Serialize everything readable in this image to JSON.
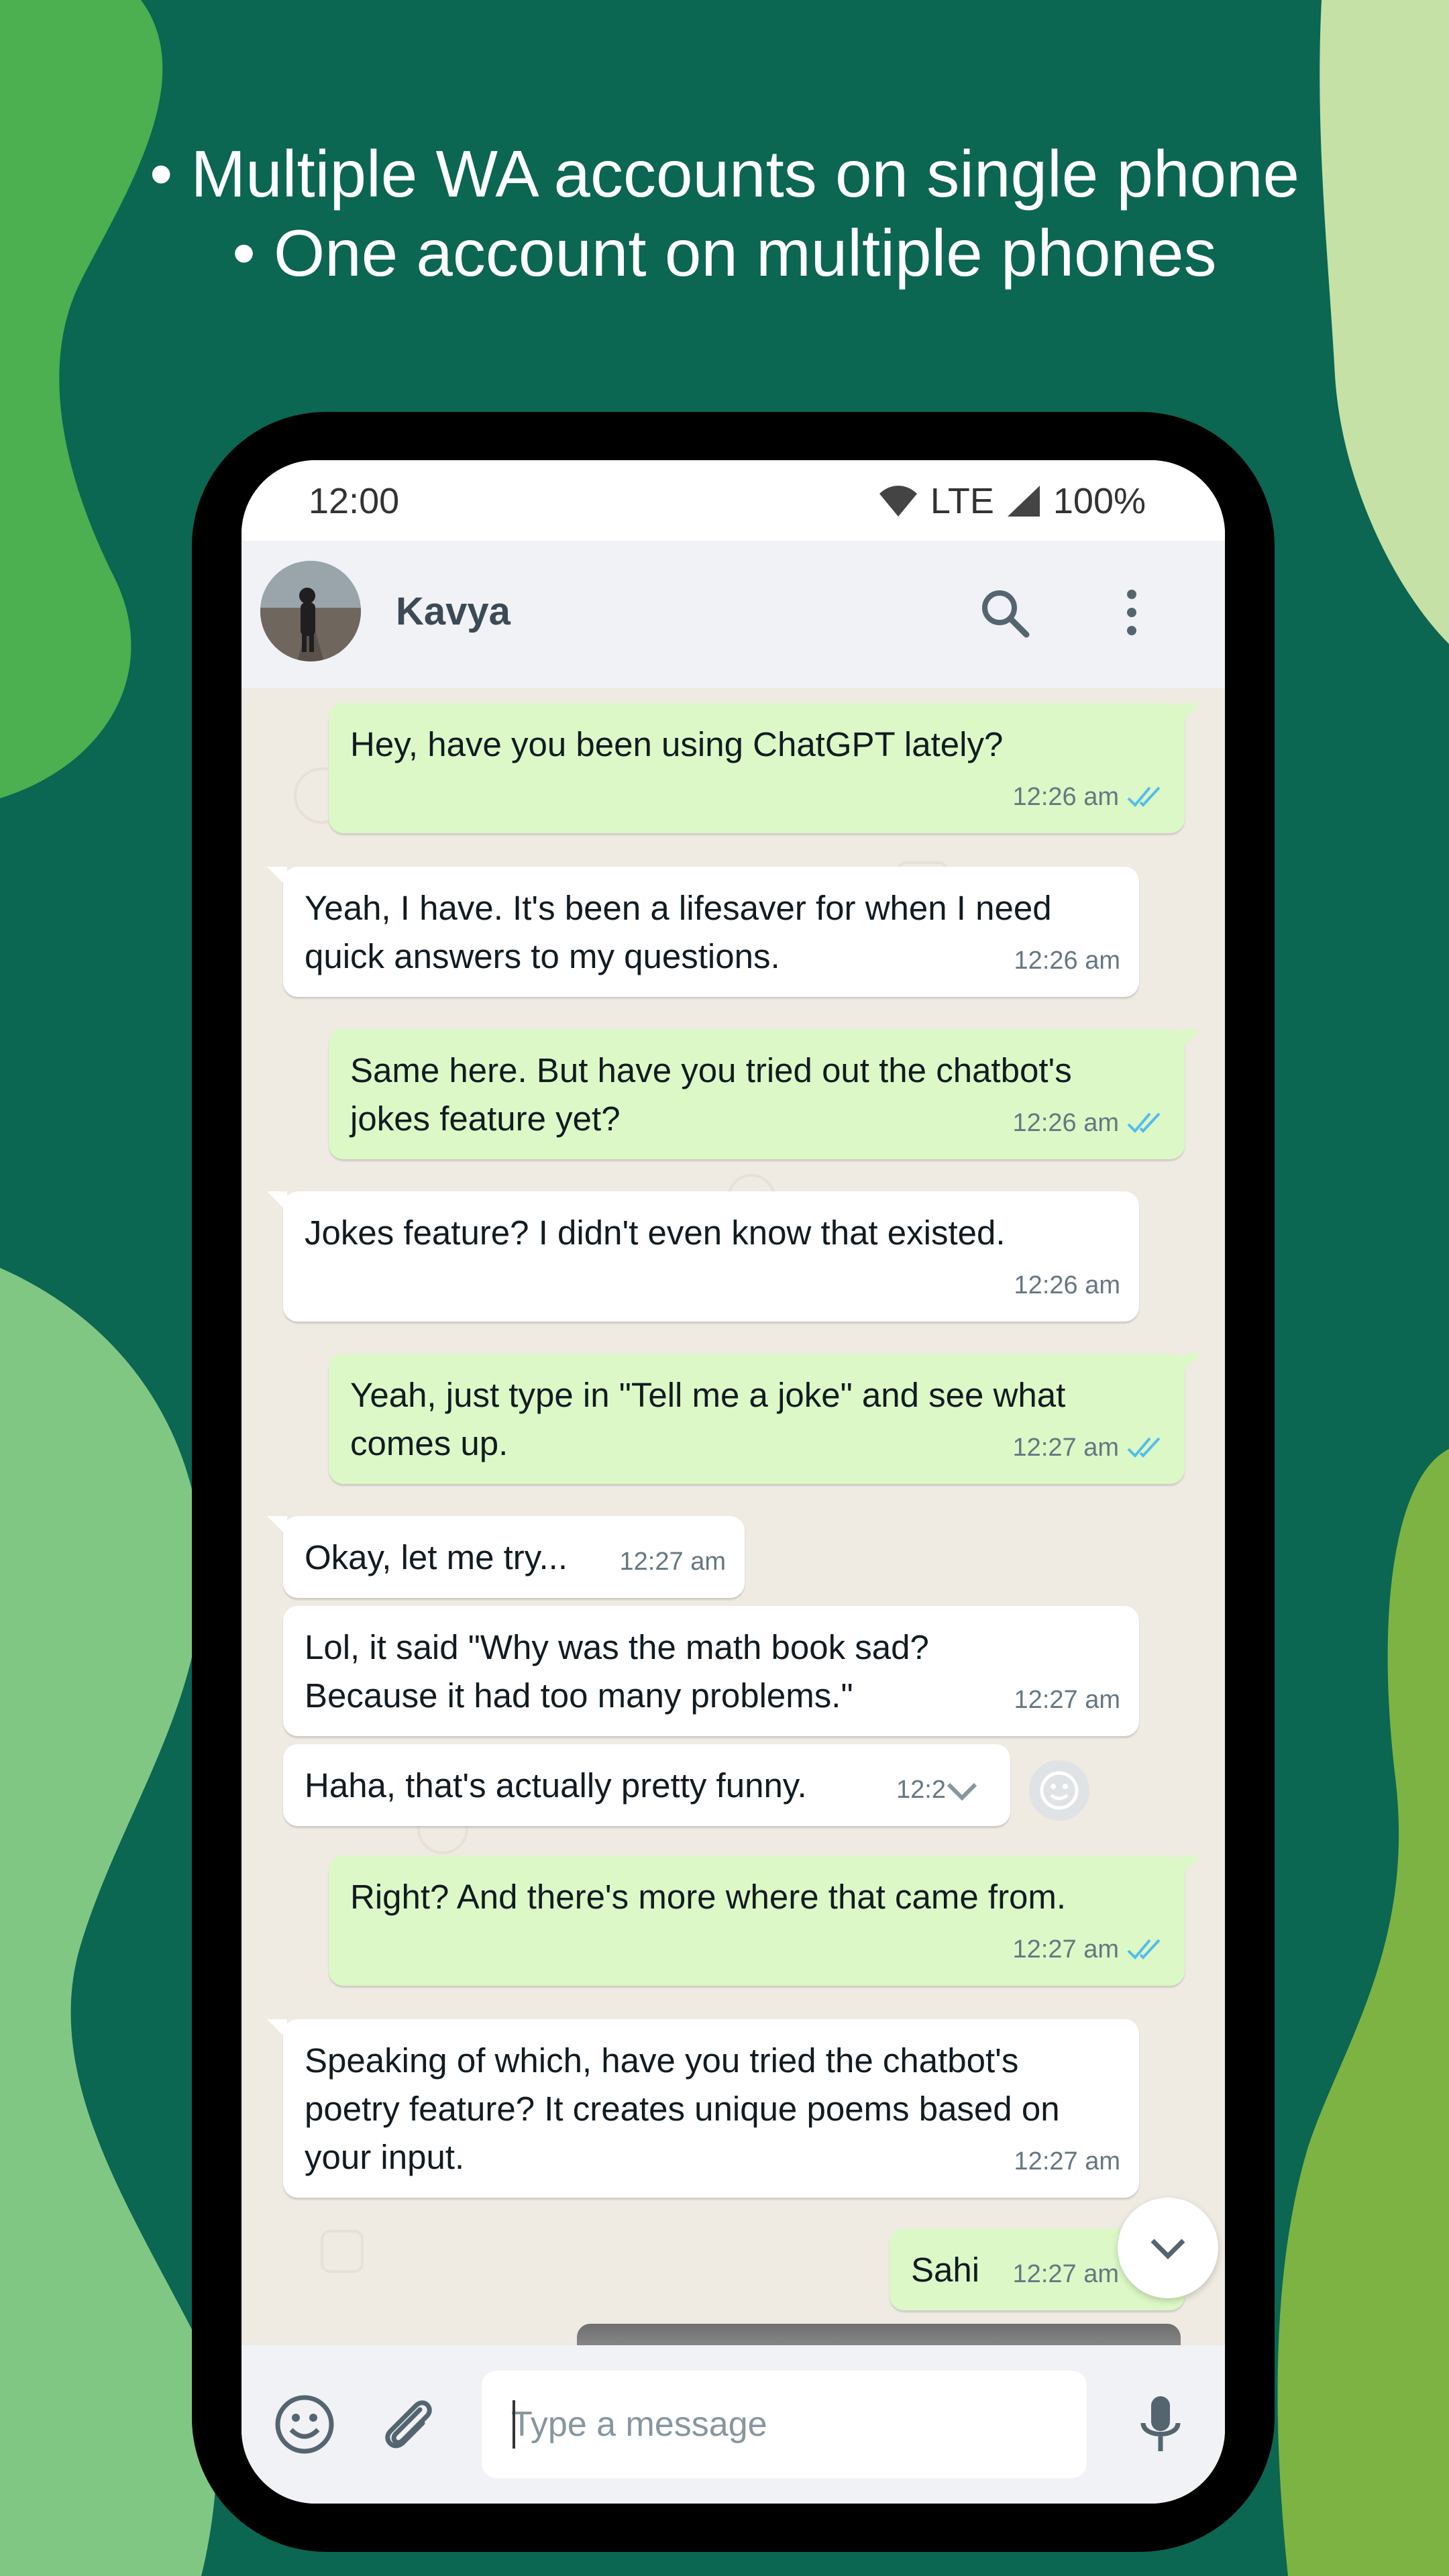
{
  "promo": {
    "line1": "• Multiple WA accounts on single phone",
    "line2": "• One account on multiple phones"
  },
  "status_bar": {
    "time": "12:00",
    "network": "LTE",
    "battery": "100%"
  },
  "chat_header": {
    "contact_name": "Kavya"
  },
  "messages": [
    {
      "dir": "out",
      "text": "Hey, have you been using ChatGPT lately?",
      "time": "12:26 am",
      "read": true
    },
    {
      "dir": "in",
      "text": "Yeah, I have. It's been a lifesaver for when I need\nquick answers to my questions.",
      "time": "12:26 am"
    },
    {
      "dir": "out",
      "text": "Same here. But have you tried out the chatbot's\njokes feature yet?",
      "time": "12:26 am",
      "read": true
    },
    {
      "dir": "in",
      "text": "Jokes feature? I didn't even know that existed.",
      "time": "12:26 am"
    },
    {
      "dir": "out",
      "text": "Yeah, just type in \"Tell me a joke\" and see what\ncomes up.",
      "time": "12:27 am",
      "read": true
    },
    {
      "dir": "in",
      "text": "Okay, let me try...",
      "time": "12:27 am"
    },
    {
      "dir": "in",
      "text": "Lol, it said \"Why was the math book sad?\nBecause it had too many problems.\"",
      "time": "12:27 am"
    },
    {
      "dir": "in",
      "text": "Haha, that's actually pretty funny.",
      "time": "12:2"
    },
    {
      "dir": "out",
      "text": "Right? And there's more where that came from.",
      "time": "12:27 am",
      "read": true
    },
    {
      "dir": "in",
      "text": "Speaking of which, have you tried the chatbot's\npoetry feature? It creates unique poems based on\nyour input.",
      "time": "12:27 am"
    },
    {
      "dir": "out",
      "text": "Sahi",
      "time": "12:27 am",
      "read": true
    }
  ],
  "composer": {
    "placeholder": "Type a message"
  },
  "icons": {
    "search": "search-icon",
    "menu": "more-vertical-icon",
    "emoji": "emoji-icon",
    "attach": "paperclip-icon",
    "mic": "mic-icon",
    "scroll_down": "chevron-down-icon"
  },
  "colors": {
    "background": "#0b6652",
    "outgoing_bubble": "#dcf8c6",
    "incoming_bubble": "#ffffff",
    "read_tick": "#53bdeb"
  }
}
